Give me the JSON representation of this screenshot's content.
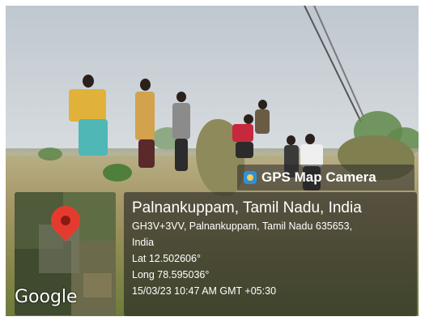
{
  "overlay": {
    "app_name": "GPS Map Camera",
    "location_title": "Palnankuppam, Tamil Nadu, India",
    "address_line1": "GH3V+3VV, Palnankuppam, Tamil Nadu 635653,",
    "address_line2": "India",
    "latitude": "Lat 12.502606°",
    "longitude": "Long 78.595036°",
    "timestamp": "15/03/23 10:47 AM GMT +05:30"
  },
  "map": {
    "provider_logo": "Google",
    "pin_color": "#e53b2f"
  },
  "icons": {
    "camera": "gps-camera-icon",
    "pin": "map-pin-icon"
  }
}
